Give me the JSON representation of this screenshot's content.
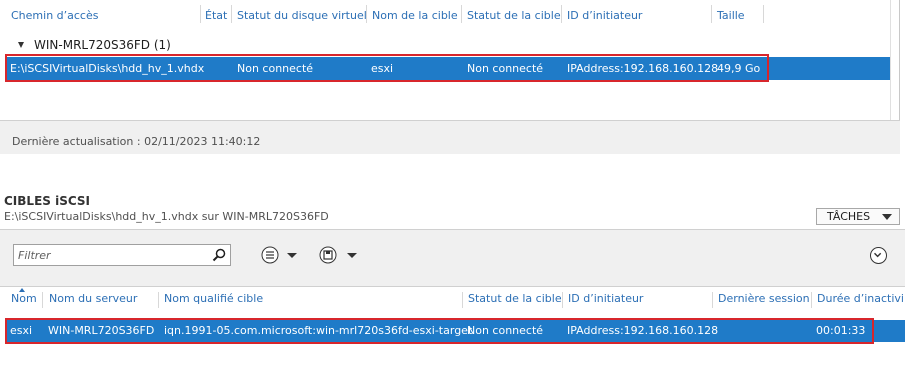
{
  "top_table": {
    "columns": [
      "Chemin d’accès",
      "État",
      "Statut du disque virtuel",
      "Nom de la cible",
      "Statut de la cible",
      "ID d’initiateur",
      "Taille"
    ],
    "group_label": "WIN-MRL720S36FD (1)",
    "row": {
      "path": "E:\\iSCSIVirtualDisks\\hdd_hv_1.vhdx",
      "disk_status": "Non connecté",
      "target_name": "esxi",
      "target_status": "Non connecté",
      "initiator_id": "IPAddress:192.168.160.128",
      "size": "49,9 Go"
    },
    "status_bar": "Dernière actualisation : 02/11/2023 11:40:12"
  },
  "targets_section": {
    "title": "CIBLES iSCSI",
    "subtitle": "E:\\iSCSIVirtualDisks\\hdd_hv_1.vhdx sur WIN-MRL720S36FD",
    "tasks_label": "TÂCHES",
    "filter_placeholder": "Filtrer",
    "columns": [
      "Nom",
      "Nom du serveur",
      "Nom qualifié cible",
      "Statut de la cible",
      "ID d’initiateur",
      "Dernière session",
      "Durée d’inactivi"
    ],
    "row": {
      "name": "esxi",
      "server": "WIN-MRL720S36FD",
      "iqn": "iqn.1991-05.com.microsoft:win-mrl720s36fd-esxi-target",
      "status": "Non connecté",
      "initiator_id": "IPAddress:192.168.160.128",
      "last_session": "",
      "idle": "00:01:33"
    }
  },
  "colors": {
    "accent": "#1f7bc8",
    "header_text": "#2c6fb5",
    "highlight_box": "#d8262c"
  }
}
